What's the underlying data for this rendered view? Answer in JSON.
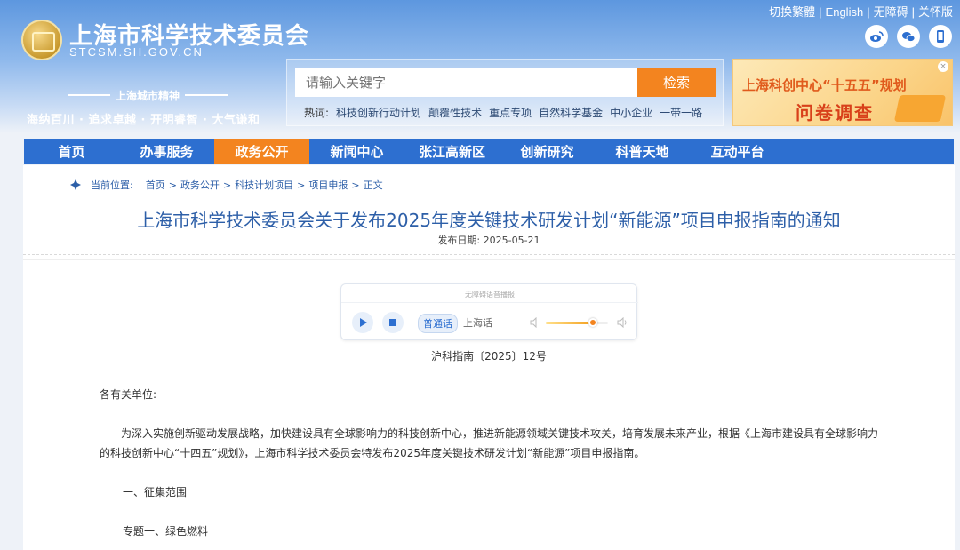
{
  "header": {
    "top_links": [
      "切换繁體",
      "English",
      "无障碍",
      "关怀版"
    ],
    "site_name": "上海市科学技术委员会",
    "site_domain": "STCSM.SH.GOV.CN",
    "spirit_title": "上海城市精神",
    "spirit_text": "海纳百川 · 追求卓越 · 开明睿智 · 大气谦和",
    "social_icons": [
      "weibo-icon",
      "wechat-icon",
      "mobile-icon"
    ]
  },
  "search": {
    "placeholder": "请输入关键字",
    "button_label": "检索",
    "hot_label": "热词:",
    "hot_words": [
      "科技创新行动计划",
      "颠覆性技术",
      "重点专项",
      "自然科学基金",
      "中小企业",
      "一带一路"
    ]
  },
  "banner": {
    "line1": "上海科创中心“十五五”规划",
    "line2": "问卷调查",
    "close": "×"
  },
  "nav": {
    "items": [
      "首页",
      "办事服务",
      "政务公开",
      "新闻中心",
      "张江高新区",
      "创新研究",
      "科普天地",
      "互动平台"
    ],
    "active_index": 2,
    "accent_color": "#f3841f",
    "bar_color": "#2d6fd0"
  },
  "breadcrumb": {
    "label": "当前位置:",
    "items": [
      "首页",
      "政务公开",
      "科技计划项目",
      "项目申报",
      "正文"
    ],
    "separator": ">"
  },
  "article": {
    "title": "上海市科学技术委员会关于发布2025年度关键技术研发计划“新能源”项目申报指南的通知",
    "date": "发布日期: 2025-05-21",
    "doc_no": "沪科指南〔2025〕12号",
    "salutation": "各有关单位:",
    "body": "为深入实施创新驱动发展战略，加快建设具有全球影响力的科技创新中心，推进新能源领域关键技术攻关，培育发展未来产业，根据《上海市建设具有全球影响力的科技创新中心“十四五”规划》，上海市科学技术委员会特发布2025年度关键技术研发计划“新能源”项目申报指南。",
    "section": "一、征集范围",
    "topic": "专题一、绿色燃料"
  },
  "player": {
    "header": "无障碍语音播报",
    "lang_on": "普通话",
    "lang_off": "上海话",
    "volume": 0.75
  }
}
